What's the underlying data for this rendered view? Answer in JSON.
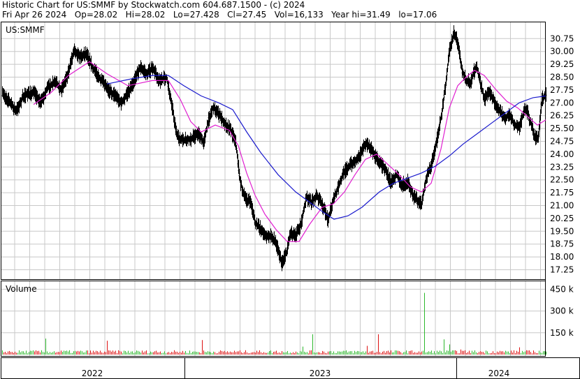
{
  "header": {
    "line1": "Historic Chart for US:SMMF by Stockwatch.com 604.687.1500 - (c) 2024",
    "line2": "Fri Apr 26 2024   Op=28.02   Hi=28.02   Lo=27.428   Cl=27.45   Vol=16,133   Year hi=31.49   lo=17.06"
  },
  "colors": {
    "price_bars": "#000000",
    "ma_short": "#e020d0",
    "ma_long": "#1a1acd",
    "volume_up": "#2db82d",
    "volume_down": "#dd1111",
    "grid": "#c8c8c8"
  },
  "chart_data": [
    {
      "type": "ohlc",
      "title": "US:SMMF",
      "y_ticks": [
        "30.75",
        "30.00",
        "29.25",
        "28.50",
        "27.75",
        "27.00",
        "26.25",
        "25.50",
        "24.75",
        "24.00",
        "23.25",
        "22.50",
        "21.75",
        "21.00",
        "20.25",
        "19.50",
        "18.75",
        "18.00",
        "17.25"
      ],
      "ylim": [
        16.7,
        31.7
      ],
      "x_labels": [
        "2022",
        "2023",
        "2024"
      ],
      "grid": true,
      "series": [
        {
          "kind": "close",
          "points": [
            [
              0,
              27.5
            ],
            [
              10,
              27.1
            ],
            [
              20,
              26.5
            ],
            [
              30,
              27.4
            ],
            [
              45,
              27.6
            ],
            [
              55,
              27.0
            ],
            [
              65,
              27.9
            ],
            [
              75,
              28.2
            ],
            [
              85,
              27.8
            ],
            [
              95,
              28.8
            ],
            [
              103,
              30.2
            ],
            [
              110,
              29.7
            ],
            [
              120,
              29.9
            ],
            [
              130,
              29.0
            ],
            [
              140,
              28.4
            ],
            [
              150,
              27.8
            ],
            [
              160,
              27.5
            ],
            [
              170,
              27.0
            ],
            [
              180,
              27.6
            ],
            [
              190,
              28.4
            ],
            [
              197,
              29.1
            ],
            [
              205,
              28.7
            ],
            [
              215,
              29.0
            ],
            [
              225,
              28.3
            ],
            [
              235,
              28.5
            ],
            [
              242,
              27.0
            ],
            [
              250,
              25.0
            ],
            [
              260,
              24.8
            ],
            [
              270,
              24.9
            ],
            [
              280,
              25.2
            ],
            [
              288,
              24.7
            ],
            [
              295,
              26.0
            ],
            [
              302,
              26.8
            ],
            [
              310,
              26.3
            ],
            [
              318,
              25.8
            ],
            [
              326,
              25.5
            ],
            [
              334,
              24.7
            ],
            [
              340,
              22.5
            ],
            [
              347,
              21.4
            ],
            [
              355,
              21.2
            ],
            [
              362,
              20.0
            ],
            [
              370,
              19.6
            ],
            [
              378,
              19.2
            ],
            [
              386,
              19.2
            ],
            [
              392,
              18.8
            ],
            [
              400,
              17.6
            ],
            [
              406,
              18.2
            ],
            [
              412,
              19.4
            ],
            [
              420,
              19.3
            ],
            [
              428,
              20.0
            ],
            [
              435,
              21.5
            ],
            [
              442,
              21.2
            ],
            [
              450,
              21.6
            ],
            [
              458,
              21.0
            ],
            [
              466,
              20.2
            ],
            [
              474,
              21.4
            ],
            [
              480,
              22.0
            ],
            [
              488,
              22.9
            ],
            [
              496,
              23.3
            ],
            [
              504,
              23.6
            ],
            [
              512,
              24.0
            ],
            [
              520,
              24.6
            ],
            [
              526,
              24.4
            ],
            [
              532,
              24.0
            ],
            [
              540,
              23.5
            ],
            [
              548,
              23.1
            ],
            [
              556,
              22.4
            ],
            [
              564,
              22.8
            ],
            [
              572,
              22.2
            ],
            [
              580,
              22.4
            ],
            [
              587,
              21.6
            ],
            [
              594,
              21.3
            ],
            [
              600,
              21.1
            ],
            [
              606,
              22.5
            ],
            [
              614,
              23.4
            ],
            [
              620,
              24.4
            ],
            [
              628,
              26.2
            ],
            [
              634,
              27.9
            ],
            [
              640,
              30.1
            ],
            [
              646,
              31.1
            ],
            [
              652,
              30.5
            ],
            [
              658,
              28.9
            ],
            [
              664,
              28.3
            ],
            [
              670,
              28.2
            ],
            [
              678,
              29.2
            ],
            [
              684,
              28.2
            ],
            [
              690,
              27.2
            ],
            [
              697,
              27.6
            ],
            [
              704,
              27.1
            ],
            [
              711,
              26.6
            ],
            [
              718,
              26.1
            ],
            [
              726,
              26.3
            ],
            [
              733,
              25.7
            ],
            [
              740,
              25.6
            ],
            [
              747,
              26.6
            ],
            [
              752,
              26.4
            ],
            [
              758,
              25.6
            ],
            [
              762,
              25.0
            ],
            [
              767,
              24.9
            ],
            [
              772,
              27.2
            ],
            [
              778,
              27.45
            ]
          ]
        },
        {
          "kind": "ma_short",
          "points": [
            [
              45,
              26.9
            ],
            [
              70,
              27.6
            ],
            [
              95,
              28.6
            ],
            [
              125,
              29.4
            ],
            [
              150,
              28.7
            ],
            [
              180,
              28.0
            ],
            [
              215,
              28.3
            ],
            [
              238,
              28.3
            ],
            [
              255,
              27.2
            ],
            [
              270,
              25.9
            ],
            [
              285,
              25.3
            ],
            [
              305,
              25.7
            ],
            [
              325,
              25.4
            ],
            [
              338,
              24.5
            ],
            [
              350,
              22.9
            ],
            [
              362,
              21.6
            ],
            [
              376,
              20.5
            ],
            [
              392,
              19.6
            ],
            [
              408,
              18.9
            ],
            [
              425,
              18.9
            ],
            [
              440,
              19.9
            ],
            [
              458,
              20.9
            ],
            [
              474,
              21.1
            ],
            [
              490,
              21.8
            ],
            [
              505,
              22.8
            ],
            [
              520,
              23.7
            ],
            [
              536,
              24.0
            ],
            [
              552,
              23.4
            ],
            [
              568,
              22.8
            ],
            [
              584,
              22.1
            ],
            [
              600,
              21.8
            ],
            [
              614,
              22.3
            ],
            [
              628,
              24.3
            ],
            [
              640,
              26.7
            ],
            [
              652,
              28.0
            ],
            [
              664,
              28.5
            ],
            [
              676,
              28.9
            ],
            [
              690,
              28.6
            ],
            [
              706,
              27.8
            ],
            [
              722,
              27.1
            ],
            [
              738,
              26.7
            ],
            [
              752,
              26.2
            ],
            [
              766,
              25.7
            ],
            [
              778,
              26.0
            ]
          ]
        },
        {
          "kind": "ma_long",
          "points": [
            [
              150,
              28.1
            ],
            [
              185,
              28.4
            ],
            [
              215,
              28.6
            ],
            [
              238,
              28.6
            ],
            [
              260,
              28.0
            ],
            [
              285,
              27.4
            ],
            [
              310,
              27.0
            ],
            [
              330,
              26.6
            ],
            [
              350,
              25.3
            ],
            [
              370,
              24.1
            ],
            [
              395,
              22.8
            ],
            [
              420,
              21.8
            ],
            [
              440,
              21.2
            ],
            [
              460,
              20.6
            ],
            [
              475,
              20.2
            ],
            [
              495,
              20.4
            ],
            [
              515,
              20.9
            ],
            [
              540,
              21.8
            ],
            [
              560,
              22.3
            ],
            [
              580,
              22.6
            ],
            [
              600,
              22.9
            ],
            [
              620,
              23.3
            ],
            [
              640,
              23.9
            ],
            [
              660,
              24.6
            ],
            [
              680,
              25.2
            ],
            [
              700,
              25.8
            ],
            [
              720,
              26.4
            ],
            [
              740,
              27.0
            ],
            [
              760,
              27.3
            ],
            [
              778,
              27.4
            ]
          ]
        }
      ]
    },
    {
      "type": "bar",
      "title": "Volume",
      "y_ticks": [
        "450 k",
        "300 k",
        "150 k"
      ],
      "ylim": [
        0,
        500
      ],
      "spikes": [
        [
          22,
          12
        ],
        [
          38,
          18
        ],
        [
          62,
          110
        ],
        [
          150,
          95
        ],
        [
          287,
          100
        ],
        [
          431,
          55
        ],
        [
          444,
          140
        ],
        [
          522,
          60
        ],
        [
          539,
          140
        ],
        [
          605,
          425
        ],
        [
          633,
          105
        ],
        [
          640,
          70
        ],
        [
          657,
          35
        ],
        [
          741,
          50
        ]
      ]
    }
  ]
}
